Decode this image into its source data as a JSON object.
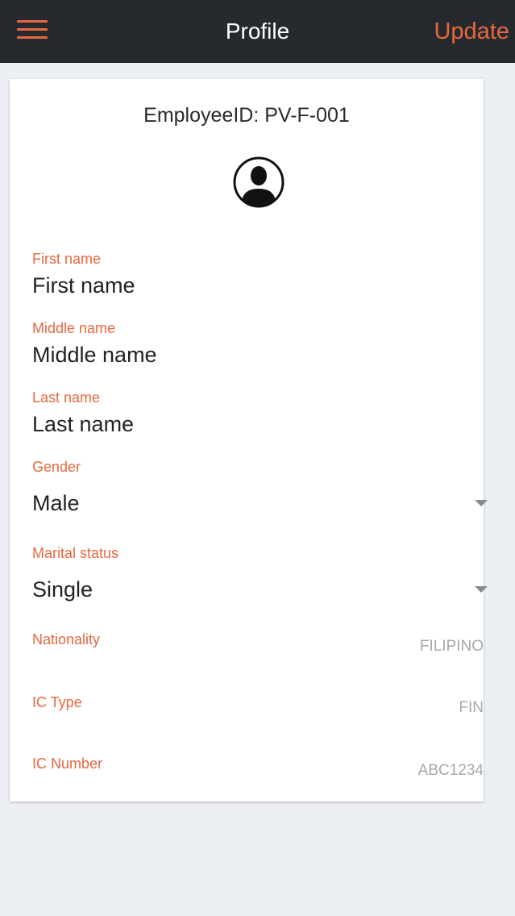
{
  "header": {
    "title": "Profile",
    "update_label": "Update",
    "menu_icon": "hamburger-menu-icon"
  },
  "profile": {
    "employee_id": "EmployeeID: PV-F-001",
    "avatar_icon": "user-avatar-icon"
  },
  "fields": {
    "first_name": {
      "label": "First name",
      "placeholder": "First name"
    },
    "middle_name": {
      "label": "Middle name",
      "placeholder": "Middle name"
    },
    "last_name": {
      "label": "Last name",
      "placeholder": "Last name"
    },
    "gender": {
      "label": "Gender",
      "value": "Male"
    },
    "marital_status": {
      "label": "Marital status",
      "value": "Single"
    },
    "nationality": {
      "label": "Nationality",
      "value": "FILIPINO"
    },
    "ic_type": {
      "label": "IC Type",
      "value": "FIN"
    },
    "ic_number": {
      "label": "IC Number",
      "value": "ABC1234"
    }
  },
  "colors": {
    "accent": "#e8673f",
    "header_bg": "#262a2e",
    "page_bg": "#eceff4"
  }
}
